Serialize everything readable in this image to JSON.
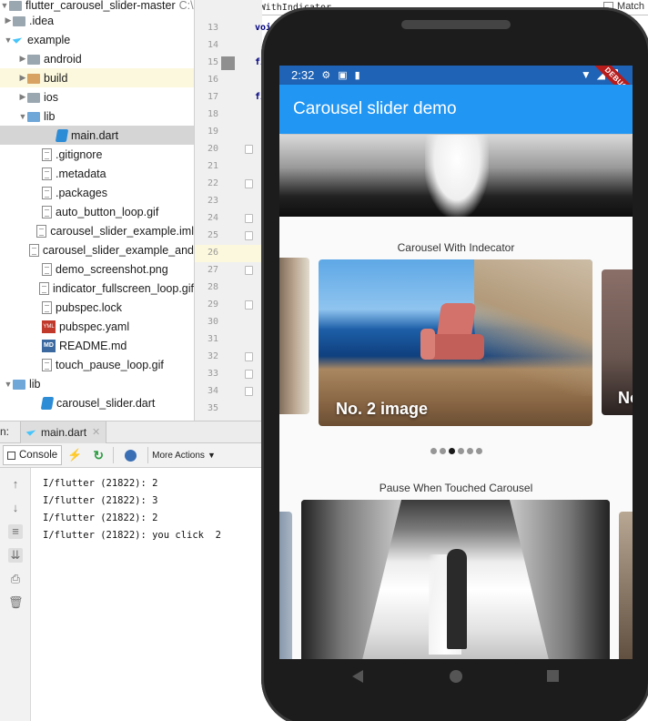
{
  "ide": {
    "project_title": "flutter_carousel_slider-master",
    "project_path": "C:\\",
    "search": {
      "value": "CarouselWithIndicator",
      "match_case_label": "Match"
    },
    "tree": [
      {
        "label": ".idea",
        "indent": 0,
        "arrow": "▶",
        "icon": "folder",
        "hl": false
      },
      {
        "label": "example",
        "indent": 0,
        "arrow": "▼",
        "icon": "flutter",
        "hl": false
      },
      {
        "label": "android",
        "indent": 1,
        "arrow": "▶",
        "icon": "folder",
        "hl": false
      },
      {
        "label": "build",
        "indent": 1,
        "arrow": "▶",
        "icon": "folder-orange",
        "hl": true
      },
      {
        "label": "ios",
        "indent": 1,
        "arrow": "▶",
        "icon": "folder",
        "hl": false
      },
      {
        "label": "lib",
        "indent": 1,
        "arrow": "▼",
        "icon": "folder-blue",
        "hl": false
      },
      {
        "label": "main.dart",
        "indent": 3,
        "arrow": "",
        "icon": "dart",
        "hl": false,
        "selected": true
      },
      {
        "label": ".gitignore",
        "indent": 2,
        "arrow": "",
        "icon": "file",
        "hl": false
      },
      {
        "label": ".metadata",
        "indent": 2,
        "arrow": "",
        "icon": "file",
        "hl": false
      },
      {
        "label": ".packages",
        "indent": 2,
        "arrow": "",
        "icon": "file",
        "hl": false
      },
      {
        "label": "auto_button_loop.gif",
        "indent": 2,
        "arrow": "",
        "icon": "file",
        "hl": false
      },
      {
        "label": "carousel_slider_example.iml",
        "indent": 2,
        "arrow": "",
        "icon": "file",
        "hl": false
      },
      {
        "label": "carousel_slider_example_and",
        "indent": 2,
        "arrow": "",
        "icon": "file",
        "hl": false
      },
      {
        "label": "demo_screenshot.png",
        "indent": 2,
        "arrow": "",
        "icon": "file",
        "hl": false
      },
      {
        "label": "indicator_fullscreen_loop.gif",
        "indent": 2,
        "arrow": "",
        "icon": "file",
        "hl": false
      },
      {
        "label": "pubspec.lock",
        "indent": 2,
        "arrow": "",
        "icon": "file",
        "hl": false
      },
      {
        "label": "pubspec.yaml",
        "indent": 2,
        "arrow": "",
        "icon": "yml",
        "hl": false
      },
      {
        "label": "README.md",
        "indent": 2,
        "arrow": "",
        "icon": "md",
        "hl": false
      },
      {
        "label": "touch_pause_loop.gif",
        "indent": 2,
        "arrow": "",
        "icon": "file",
        "hl": false
      },
      {
        "label": "lib",
        "indent": 0,
        "arrow": "▼",
        "icon": "folder-blue",
        "hl": false
      },
      {
        "label": "carousel_slider.dart",
        "indent": 2,
        "arrow": "",
        "icon": "dart",
        "hl": false
      }
    ],
    "line_numbers": [
      "13",
      "14",
      "15",
      "16",
      "17",
      "18",
      "19",
      "20",
      "21",
      "22",
      "23",
      "24",
      "25",
      "26",
      "27",
      "28",
      "29",
      "30",
      "31",
      "32",
      "33",
      "34",
      "35"
    ],
    "code_fragments": [
      "voi",
      "fi",
      "fi"
    ],
    "run": {
      "prefix": "n:",
      "tab_label": "main.dart",
      "console_label": "Console",
      "more_actions_label": "More Actions",
      "lines": [
        "I/flutter (21822): 2",
        "I/flutter (21822): 3",
        "I/flutter (21822): 2",
        "I/flutter (21822): you click  2"
      ]
    }
  },
  "phone": {
    "status_time": "2:32",
    "debug_label": "DEBUG",
    "app_title": "Carousel slider demo",
    "section1_title": "Carousel With Indecator",
    "card1_caption": "No. 2 image",
    "card2_caption": "No",
    "dots_count": 6,
    "active_dot": 2,
    "section2_title": "Pause When Touched Carousel"
  },
  "colors": {
    "appbar": "#2196f3",
    "statusbar": "#1e63b5",
    "debug_ribbon": "#b71c1c"
  }
}
